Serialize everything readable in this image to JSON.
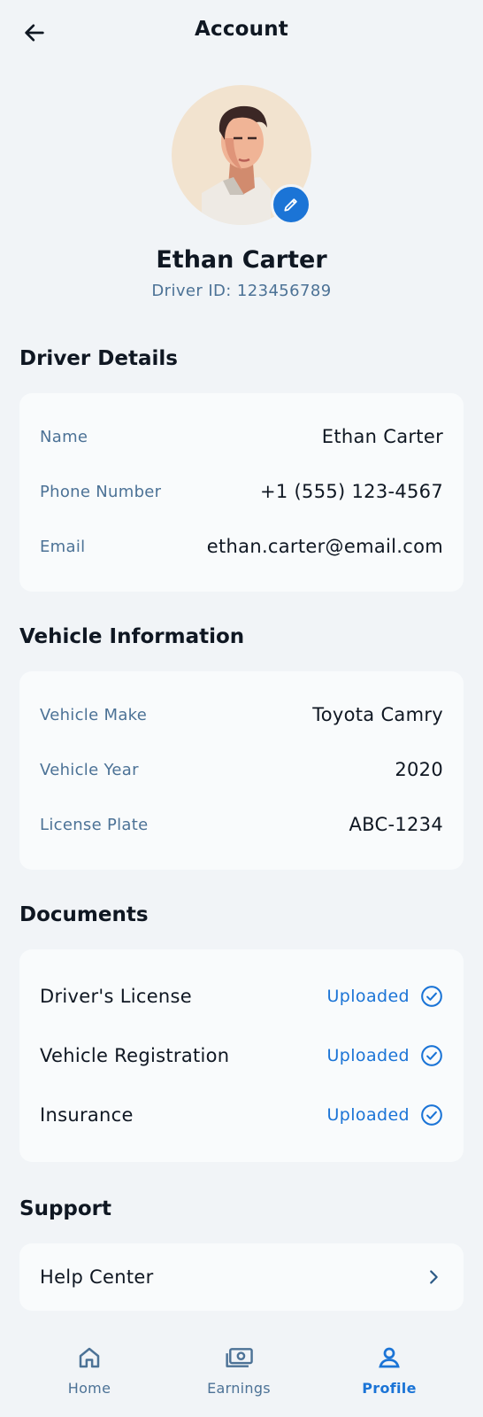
{
  "header": {
    "title": "Account",
    "back_icon": "arrow-left-icon"
  },
  "profile": {
    "name": "Ethan Carter",
    "driver_id": "Driver ID: 123456789",
    "edit_icon": "pencil-icon"
  },
  "driver_details": {
    "title": "Driver Details",
    "rows": [
      {
        "label": "Name",
        "value": "Ethan Carter"
      },
      {
        "label": "Phone Number",
        "value": "+1 (555) 123-4567"
      },
      {
        "label": "Email",
        "value": "ethan.carter@email.com"
      }
    ]
  },
  "vehicle_info": {
    "title": "Vehicle Information",
    "rows": [
      {
        "label": "Vehicle Make",
        "value": "Toyota Camry"
      },
      {
        "label": "Vehicle Year",
        "value": "2020"
      },
      {
        "label": "License Plate",
        "value": "ABC-1234"
      }
    ]
  },
  "documents": {
    "title": "Documents",
    "items": [
      {
        "name": "Driver's License",
        "status": "Uploaded"
      },
      {
        "name": "Vehicle Registration",
        "status": "Uploaded"
      },
      {
        "name": "Insurance",
        "status": "Uploaded"
      }
    ]
  },
  "support": {
    "title": "Support",
    "items": [
      {
        "label": "Help Center"
      }
    ]
  },
  "nav": {
    "items": [
      {
        "label": "Home",
        "icon": "home-icon",
        "active": false
      },
      {
        "label": "Earnings",
        "icon": "money-icon",
        "active": false
      },
      {
        "label": "Profile",
        "icon": "person-icon",
        "active": true
      }
    ]
  },
  "colors": {
    "accent": "#1b74d6",
    "label": "#4c7296",
    "background": "#f1f4f7",
    "card": "#f9fbfc"
  }
}
